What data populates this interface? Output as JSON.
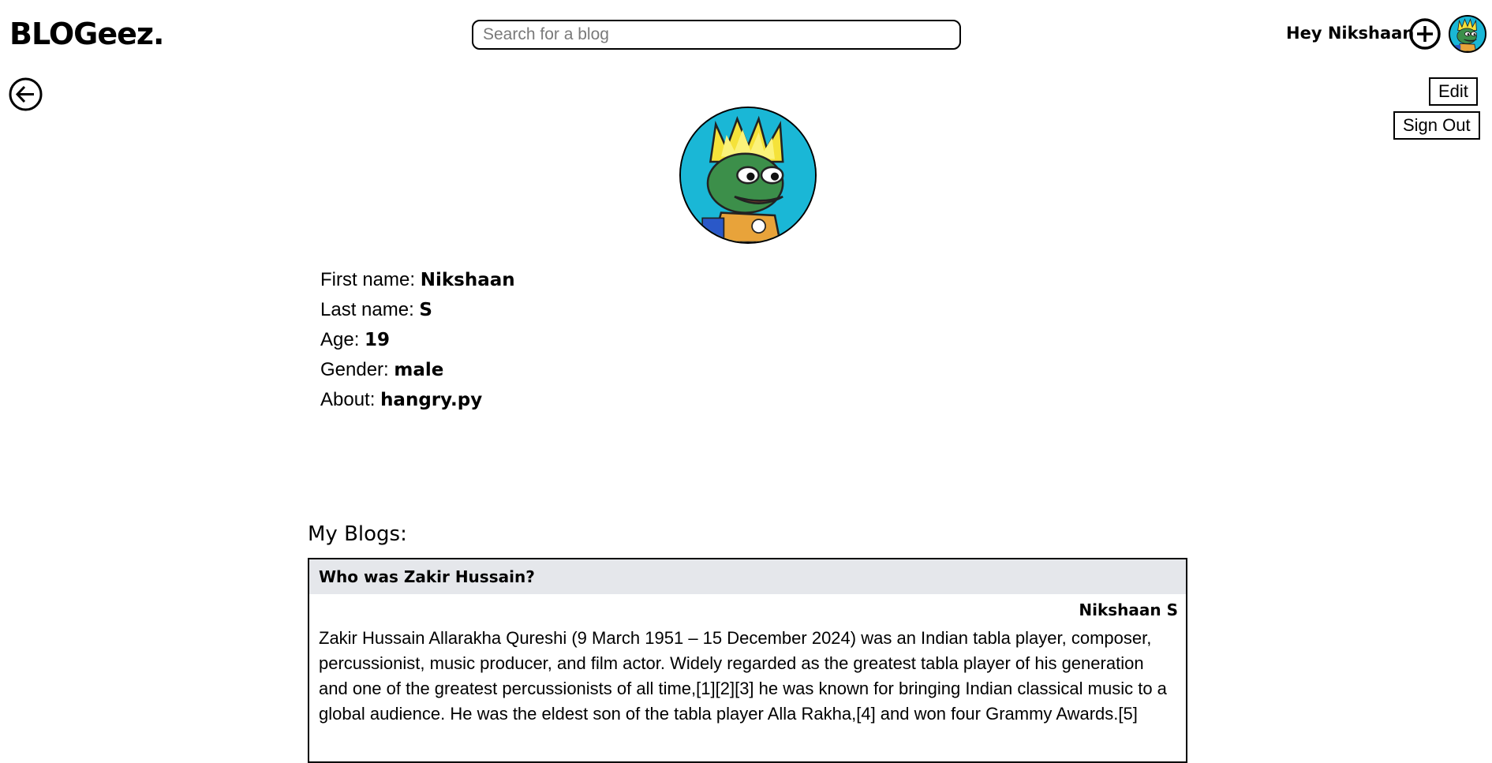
{
  "header": {
    "logo": "BLOGeez.",
    "search_placeholder": "Search for a blog",
    "greeting": "Hey Nikshaan",
    "add_icon": "plus-circle-icon"
  },
  "actions": {
    "edit_label": "Edit",
    "signout_label": "Sign Out",
    "back_icon": "arrow-left-circle-icon"
  },
  "profile": {
    "fields": [
      {
        "label": "First name: ",
        "value": "Nikshaan"
      },
      {
        "label": "Last name: ",
        "value": "S"
      },
      {
        "label": "Age: ",
        "value": "19"
      },
      {
        "label": "Gender: ",
        "value": "male"
      },
      {
        "label": "About: ",
        "value": "hangry.py"
      }
    ]
  },
  "blogs": {
    "heading": "My Blogs:",
    "items": [
      {
        "title": "Who was Zakir Hussain?",
        "author": "Nikshaan S",
        "body": "Zakir Hussain Allarakha Qureshi (9 March 1951 – 15 December 2024) was an Indian tabla player, composer, percussionist, music producer, and film actor. Widely regarded as the greatest tabla player of his generation and one of the greatest percussionists of all time,[1][2][3] he was known for bringing Indian classical music to a global audience. He was the eldest son of the tabla player Alla Rakha,[4] and won four Grammy Awards.[5]"
      }
    ]
  },
  "colors": {
    "avatar_bg": "#1ab7d6",
    "card_header_bg": "#e5e7eb"
  }
}
